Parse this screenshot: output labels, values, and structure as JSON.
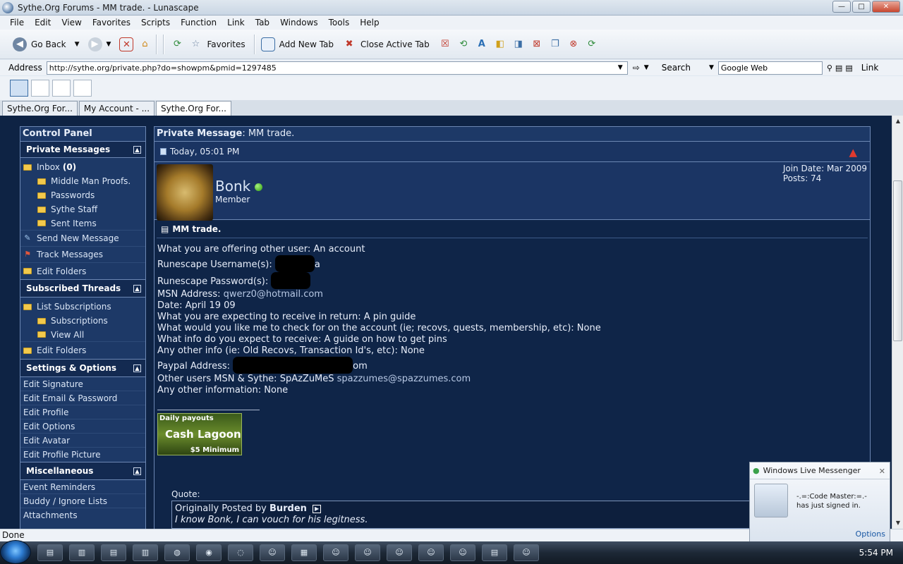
{
  "window": {
    "title": "Sythe.Org Forums - MM trade. - Lunascape",
    "btn_minimize": "—",
    "btn_maximize": "□",
    "btn_close": "✕"
  },
  "menu": [
    "File",
    "Edit",
    "View",
    "Favorites",
    "Scripts",
    "Function",
    "Link",
    "Tab",
    "Windows",
    "Tools",
    "Help"
  ],
  "toolbar": {
    "go_back": "Go Back",
    "favorites": "Favorites",
    "add_new_tab": "Add New Tab",
    "close_active_tab": "Close Active Tab"
  },
  "address": {
    "label": "Address",
    "url": "http://sythe.org/private.php?do=showpm&pmid=1297485",
    "search_label": "Search",
    "search_engine": "Google Web",
    "link_label": "Link"
  },
  "tabs": [
    "Sythe.Org For...",
    "My Account - ...",
    "Sythe.Org For..."
  ],
  "sidebar": {
    "title": "Control Panel",
    "private_messages": {
      "header": "Private Messages",
      "inbox": "Inbox",
      "inbox_count": "(0)",
      "folders": [
        "Middle Man Proofs.",
        "Passwords",
        "Sythe Staff",
        "Sent Items"
      ],
      "send_new": "Send New Message",
      "track": "Track Messages",
      "edit_folders": "Edit Folders"
    },
    "subscribed": {
      "header": "Subscribed Threads",
      "list": "List Subscriptions",
      "subscriptions": "Subscriptions",
      "view_all": "View All",
      "edit_folders": "Edit Folders"
    },
    "settings": {
      "header": "Settings & Options",
      "items": [
        "Edit Signature",
        "Edit Email & Password",
        "Edit Profile",
        "Edit Options",
        "Edit Avatar",
        "Edit Profile Picture"
      ]
    },
    "misc": {
      "header": "Miscellaneous",
      "items": [
        "Event Reminders",
        "Buddy / Ignore Lists",
        "Attachments"
      ]
    }
  },
  "pm": {
    "header_label": "Private Message",
    "header_subject": ": MM trade.",
    "date": "Today, 05:01 PM",
    "username": "Bonk",
    "user_title": "Member",
    "join_date": "Join Date: Mar 2009",
    "posts": "Posts: 74",
    "title": "MM trade.",
    "lines": {
      "l1": "What you are offering other user: An account",
      "l2a": "Runescape Username(s): ",
      "l2b": "a",
      "l3a": "Runescape Password(s): ",
      "l4a": "MSN Address: ",
      "l4b": "qwerz0@hotmail.com",
      "l5": "Date: April 19 09",
      "l6": "What you are expecting to receive in return: A pin guide",
      "l7": "What would you like me to check for on the account (ie; recovs, quests, membership, etc): None",
      "l8": "What info do you expect to receive: A guide on how to get pins",
      "l9": "Any other info (ie: Old Recovs, Transaction Id's, etc): None",
      "l10a": "Paypal Address: ",
      "l10b": "om",
      "l11a": "Other users MSN & Sythe: SpAzZuMeS ",
      "l11b": "spazzumes@spazzumes.com",
      "l12": "Any other information: None"
    },
    "banner": {
      "top": "Daily payouts",
      "main": "Cash Lagoon",
      "bottom": "$5 Minimum"
    },
    "quote_label": "Quote:",
    "quote_by_prefix": "Originally Posted by ",
    "quote_by": "Burden",
    "quote_text": "I know Bonk, I can vouch for his legitness."
  },
  "status": "Done",
  "messenger": {
    "title": "Windows Live Messenger",
    "line1": "-.=:Code Master:=.-",
    "line2": "has just signed in.",
    "options": "Options"
  },
  "clock": "5:54 PM"
}
